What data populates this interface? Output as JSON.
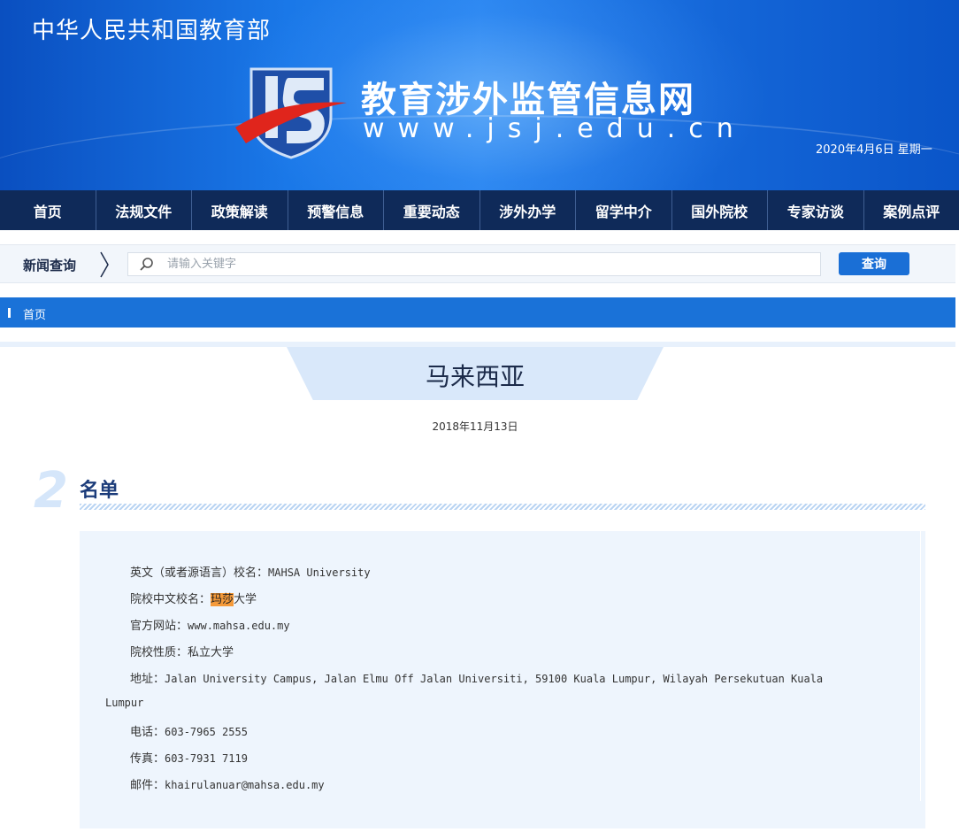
{
  "header": {
    "ministry": "中华人民共和国教育部",
    "site_title": "教育涉外监管信息网",
    "site_url": "www.jsj.edu.cn",
    "date_line": "2020年4月6日 星期一",
    "colors": {
      "banner": "#1a78e8",
      "nav": "#0f2a59",
      "accent": "#1a72d8"
    }
  },
  "nav": {
    "items": [
      {
        "label": "首页"
      },
      {
        "label": "法规文件"
      },
      {
        "label": "政策解读"
      },
      {
        "label": "预警信息"
      },
      {
        "label": "重要动态"
      },
      {
        "label": "涉外办学"
      },
      {
        "label": "留学中介"
      },
      {
        "label": "国外院校"
      },
      {
        "label": "专家访谈"
      },
      {
        "label": "案例点评"
      }
    ]
  },
  "search": {
    "label": "新闻查询",
    "placeholder": "请输入关键字",
    "value": "",
    "button": "查询"
  },
  "breadcrumb": {
    "home": "首页"
  },
  "article": {
    "country": "马来西亚",
    "date": "2018年11月13日",
    "section_number": "2",
    "section_title": "名单",
    "fields": {
      "en_name_label": "英文（或者源语言）校名：",
      "en_name_value": "MAHSA University",
      "cn_name_label": "院校中文校名：",
      "cn_name_highlight": "玛莎",
      "cn_name_rest": "大学",
      "website_label": "官方网站：",
      "website_value": "www.mahsa.edu.my",
      "type_label": "院校性质：",
      "type_value": "私立大学",
      "address_label": "地址：",
      "address_value_1": "Jalan University Campus, Jalan Elmu Off Jalan Universiti, 59100 Kuala Lumpur, Wilayah Persekutuan Kuala",
      "address_value_2": "Lumpur",
      "phone_label": "电话：",
      "phone_value": "603-7965 2555",
      "fax_label": "传真：",
      "fax_value": "603-7931 7119",
      "email_label": "邮件：",
      "email_value": "khairulanuar@mahsa.edu.my"
    }
  }
}
